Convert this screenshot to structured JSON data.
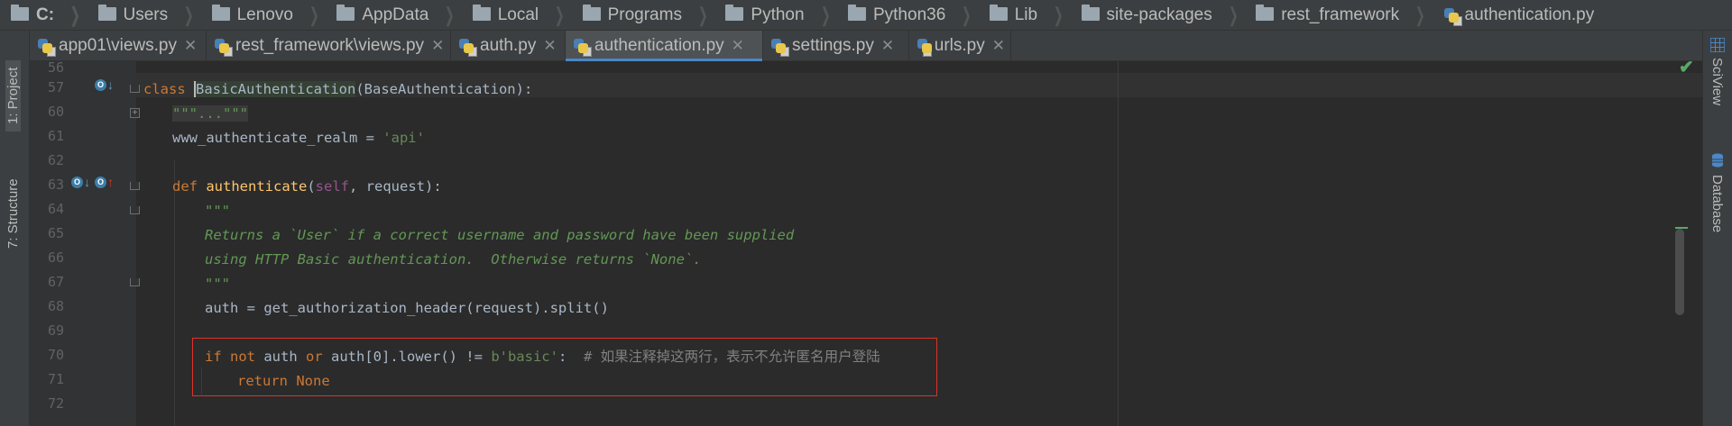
{
  "breadcrumbs": [
    "C:",
    "Users",
    "Lenovo",
    "AppData",
    "Local",
    "Programs",
    "Python",
    "Python36",
    "Lib",
    "site-packages",
    "rest_framework",
    "authentication.py"
  ],
  "tabs": [
    {
      "label": "app01\\views.py",
      "active": false
    },
    {
      "label": "rest_framework\\views.py",
      "active": false
    },
    {
      "label": "auth.py",
      "active": false
    },
    {
      "label": "authentication.py",
      "active": true
    },
    {
      "label": "settings.py",
      "active": false
    },
    {
      "label": "urls.py",
      "active": false
    }
  ],
  "tool_windows": {
    "left": [
      "1: Project",
      "7: Structure"
    ],
    "right": [
      "SciView",
      "Database"
    ]
  },
  "code": {
    "line_numbers": [
      "56",
      "57",
      "60",
      "61",
      "62",
      "63",
      "64",
      "65",
      "66",
      "67",
      "68",
      "69",
      "70",
      "71",
      "72"
    ],
    "l57_kw": "class",
    "l57_name": "BasicAuthentication",
    "l57_rest": "(BaseAuthentication):",
    "l60": "\"\"\"...\"\"\"",
    "l61_a": "www_authenticate_realm = ",
    "l61_str": "'api'",
    "l63_kw": "def",
    "l63_fn": "authenticate",
    "l63_p1": "(",
    "l63_self": "self",
    "l63_p2": ", request):",
    "l64": "\"\"\"",
    "l65": "Returns a `User` if a correct username and password have been supplied",
    "l66": "using HTTP Basic authentication.  Otherwise returns `None`.",
    "l67": "\"\"\"",
    "l68": "auth = get_authorization_header(request).split()",
    "l70_if": "if ",
    "l70_not": "not",
    "l70_a": " auth ",
    "l70_or": "or",
    "l70_b": " auth[0].lower() != ",
    "l70_str": "b'basic'",
    "l70_c": ":  ",
    "l70_cmt": "# 如果注释掉这两行，表示不允许匿名用户登陆",
    "l71_kw": "return",
    "l71_none": " None"
  },
  "colors": {
    "keyword": "#cc7832",
    "function": "#ffc66d",
    "string": "#6a8759",
    "docstring": "#629755",
    "comment": "#808080",
    "highlight_box": "#e0312a"
  }
}
